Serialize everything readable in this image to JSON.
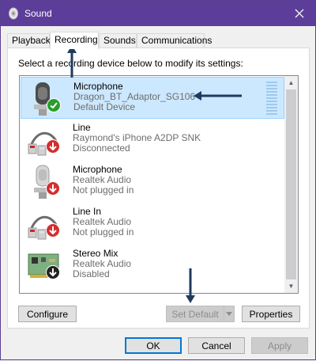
{
  "window": {
    "title": "Sound",
    "title_icon": "speaker-icon",
    "close_icon": "close-icon"
  },
  "tabs": [
    {
      "label": "Playback",
      "active": false
    },
    {
      "label": "Recording",
      "active": true
    },
    {
      "label": "Sounds",
      "active": false
    },
    {
      "label": "Communications",
      "active": false
    }
  ],
  "instruction": "Select a recording device below to modify its settings:",
  "devices": [
    {
      "name": "Microphone",
      "detail": "Dragon_BT_Adaptor_SG106",
      "status": "Default Device",
      "icon": "headset-microphone-icon",
      "badge": "check-icon",
      "badge_color": "#2a9d2a",
      "selected": true
    },
    {
      "name": "Line",
      "detail": "Raymond's iPhone A2DP SNK",
      "status": "Disconnected",
      "icon": "line-in-cable-icon",
      "badge": "down-arrow-icon",
      "badge_color": "#d32f2f",
      "selected": false
    },
    {
      "name": "Microphone",
      "detail": "Realtek Audio",
      "status": "Not plugged in",
      "icon": "microphone-icon",
      "badge": "down-arrow-icon",
      "badge_color": "#d32f2f",
      "selected": false
    },
    {
      "name": "Line In",
      "detail": "Realtek Audio",
      "status": "Not plugged in",
      "icon": "line-in-cable-icon",
      "badge": "down-arrow-icon",
      "badge_color": "#d32f2f",
      "selected": false
    },
    {
      "name": "Stereo Mix",
      "detail": "Realtek Audio",
      "status": "Disabled",
      "icon": "sound-card-icon",
      "badge": "down-arrow-icon",
      "badge_color": "#222222",
      "selected": false
    }
  ],
  "buttons": {
    "configure": "Configure",
    "set_default": "Set Default",
    "properties": "Properties",
    "ok": "OK",
    "cancel": "Cancel",
    "apply": "Apply"
  },
  "colors": {
    "titlebar": "#5c3d99",
    "selection": "#cce8ff",
    "annotation_arrow": "#1f3a5f"
  }
}
